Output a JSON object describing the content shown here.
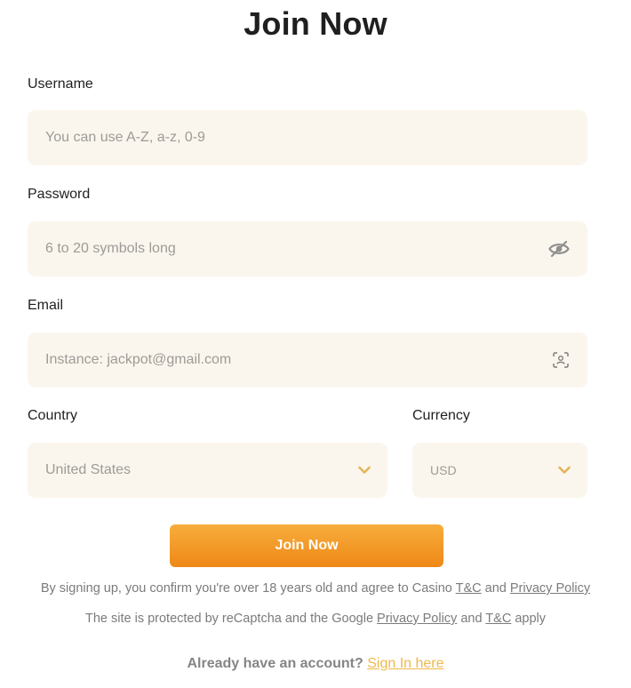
{
  "title": "Join Now",
  "username": {
    "label": "Username",
    "placeholder": "You can use A-Z, a-z, 0-9"
  },
  "password": {
    "label": "Password",
    "placeholder": "6 to 20 symbols long",
    "icon": "eye-slash-icon"
  },
  "email": {
    "label": "Email",
    "placeholder": "Instance: jackpot@gmail.com",
    "icon": "contact-scan-icon"
  },
  "country": {
    "label": "Country",
    "value": "United States"
  },
  "currency": {
    "label": "Currency",
    "value": "USD"
  },
  "submit_label": "Join Now",
  "terms": {
    "prefix": "By signing up, you confirm you're over 18 years old and agree to Casino ",
    "tc": "T&C",
    "and": " and ",
    "privacy": "Privacy Policy"
  },
  "recaptcha": {
    "prefix": "The site is protected by reCaptcha and the Google ",
    "privacy": "Privacy Policy",
    "and": " and ",
    "tc": "T&C",
    "suffix": " apply"
  },
  "signin": {
    "question": "Already have an account?",
    "link": "Sign In here"
  },
  "colors": {
    "accent": "#ee8817",
    "field_bg": "#fbf6ed",
    "chevron": "#e3b55a",
    "link": "#f0b84c"
  }
}
